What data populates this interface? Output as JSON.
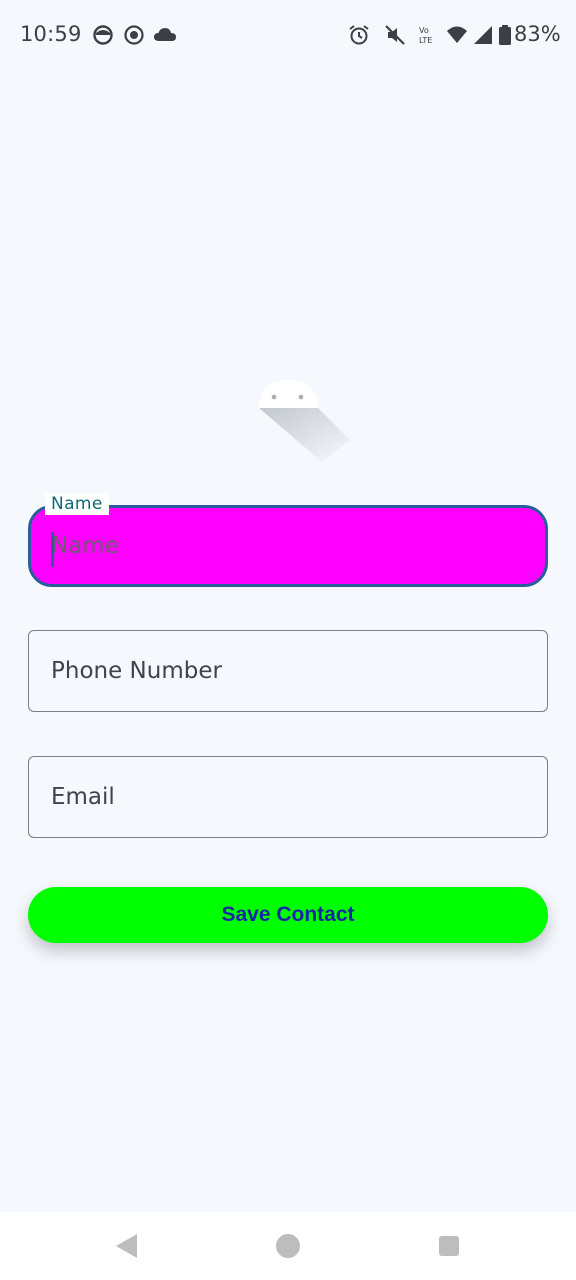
{
  "status_bar": {
    "time": "10:59",
    "battery_percent": "83%",
    "left_icons": [
      "head-icon",
      "record-icon",
      "cloud-icon"
    ],
    "right_icons": [
      "alarm-icon",
      "mute-icon",
      "volte-icon",
      "wifi-icon",
      "signal-icon",
      "battery-icon"
    ]
  },
  "form": {
    "name_field": {
      "floating_label": "Name",
      "placeholder": "Name",
      "value": ""
    },
    "phone_field": {
      "placeholder": "Phone Number",
      "value": ""
    },
    "email_field": {
      "placeholder": "Email",
      "value": ""
    },
    "save_button_label": "Save Contact"
  },
  "colors": {
    "background": "#f5f8fd",
    "name_field_fill": "#ff00ff",
    "name_field_border": "#2a5d9c",
    "floating_label": "#0e6b78",
    "save_button_fill": "#00ff00",
    "save_button_text": "#1726a6"
  },
  "nav_bar": {
    "icons": [
      "back-icon",
      "home-icon",
      "recents-icon"
    ]
  }
}
